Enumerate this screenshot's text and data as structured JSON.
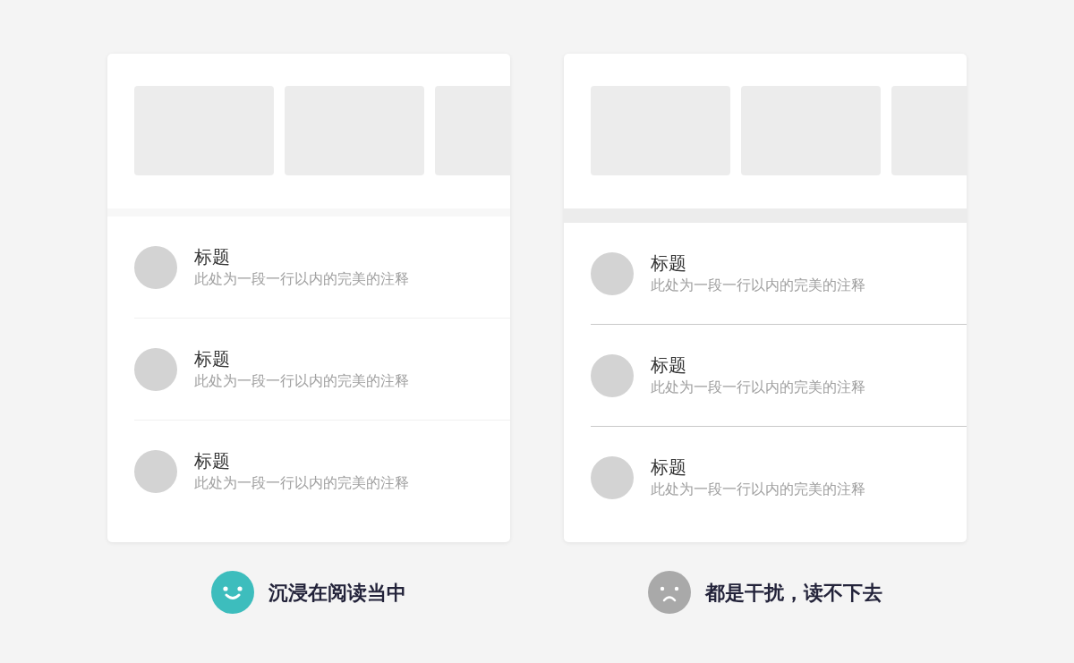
{
  "panels": [
    {
      "kind": "good",
      "thumbnails": [
        {
          "kind": "placeholder"
        },
        {
          "kind": "placeholder"
        },
        {
          "kind": "placeholder"
        }
      ],
      "items": [
        {
          "title": "标题",
          "subtitle": "此处为一段一行以内的完美的注释"
        },
        {
          "title": "标题",
          "subtitle": "此处为一段一行以内的完美的注释"
        },
        {
          "title": "标题",
          "subtitle": "此处为一段一行以内的完美的注释"
        }
      ],
      "caption": "沉浸在阅读当中",
      "color": "#3dbdbd"
    },
    {
      "kind": "bad",
      "thumbnails": [
        {
          "kind": "placeholder"
        },
        {
          "kind": "placeholder"
        },
        {
          "kind": "placeholder"
        }
      ],
      "items": [
        {
          "title": "标题",
          "subtitle": "此处为一段一行以内的完美的注释"
        },
        {
          "title": "标题",
          "subtitle": "此处为一段一行以内的完美的注释"
        },
        {
          "title": "标题",
          "subtitle": "此处为一段一行以内的完美的注释"
        }
      ],
      "caption": "都是干扰，读不下去",
      "color": "#a9a9a9"
    }
  ]
}
